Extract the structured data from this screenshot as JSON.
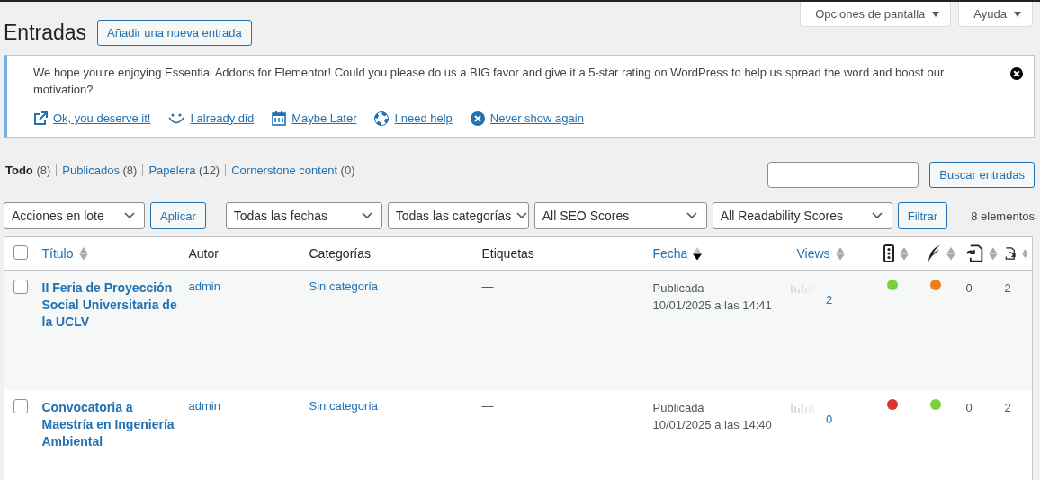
{
  "screen_tabs": [
    {
      "label": "Opciones de pantalla",
      "expanded": false
    },
    {
      "label": "Ayuda",
      "expanded": false
    }
  ],
  "title": "Entradas",
  "add_button": "Añadir una nueva entrada",
  "notice": {
    "message": "We hope you're enjoying Essential Addons for Elementor! Could you please do us a BIG favor and give it a 5-star rating on WordPress to help us spread the word and boost our motivation?",
    "links": [
      "Ok, you deserve it!",
      "I already did",
      "Maybe Later",
      "I need help",
      "Never show again"
    ]
  },
  "views": [
    {
      "label": "Todo",
      "count": "(8)",
      "selected": true
    },
    {
      "label": "Publicados",
      "count": "(8)",
      "selected": false
    },
    {
      "label": "Papelera",
      "count": "(12)",
      "selected": false
    },
    {
      "label": "Cornerstone content",
      "count": "(0)",
      "selected": false
    }
  ],
  "search_button": "Buscar entradas",
  "bulk": {
    "value": "Acciones en lote",
    "apply": "Aplicar"
  },
  "filters": [
    "Todas las fechas",
    "Todas las categorías",
    "All SEO Scores",
    "All Readability Scores"
  ],
  "filter_button": "Filtrar",
  "item_count": "8 elementos",
  "select_all": {
    "checked": false
  },
  "columns": [
    {
      "kind": "text",
      "label": "Título",
      "link": true,
      "sortable": true,
      "sorted": false
    },
    {
      "kind": "text",
      "label": "Autor",
      "link": false,
      "sortable": false
    },
    {
      "kind": "text",
      "label": "Categorías",
      "link": false,
      "sortable": false
    },
    {
      "kind": "text",
      "label": "Etiquetas",
      "link": false,
      "sortable": false
    },
    {
      "kind": "text",
      "label": "Fecha",
      "link": true,
      "sortable": true,
      "sorted": true
    },
    {
      "kind": "text",
      "label": "Views",
      "link": true,
      "sortable": true,
      "sorted": false
    },
    {
      "kind": "icon",
      "sortable": true,
      "sorted": false
    },
    {
      "kind": "icon",
      "sortable": true,
      "sorted": false
    },
    {
      "kind": "icon",
      "sortable": true,
      "sorted": false
    },
    {
      "kind": "icon",
      "sortable": true,
      "sorted": false
    }
  ],
  "rows": [
    {
      "selected": false,
      "title": "II Feria de Proyección Social Universitaria de la UCLV",
      "author": "admin",
      "category": "Sin categoría",
      "tags": "—",
      "status": "Publicada",
      "date": "10/01/2025 a las 14:41",
      "views": "2",
      "seo_score": {
        "color": "#7ad03a"
      },
      "readability_score": {
        "color": "#ee7c1b"
      },
      "links_out": "0",
      "links_in": "2"
    },
    {
      "selected": false,
      "title": "Convocatoria a Maestría en Ingeniería Ambiental",
      "author": "admin",
      "category": "Sin categoría",
      "tags": "—",
      "status": "Publicada",
      "date": "10/01/2025 a las 14:40",
      "views": "0",
      "seo_score": {
        "color": "#dc3232"
      },
      "readability_score": {
        "color": "#7ad03a"
      },
      "links_out": "0",
      "links_in": "2"
    }
  ]
}
